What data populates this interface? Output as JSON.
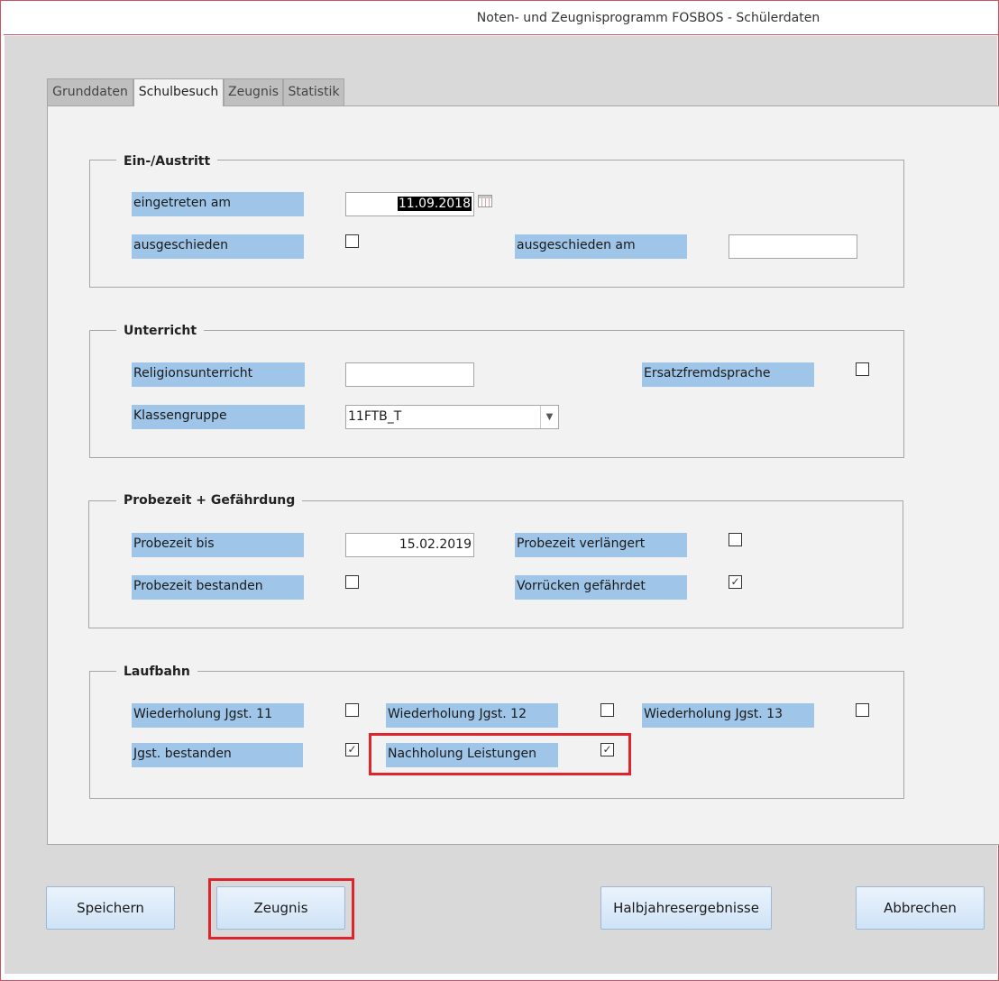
{
  "window": {
    "title": "Noten- und Zeugnisprogramm FOSBOS - Schülerdaten"
  },
  "tabs": [
    {
      "label": "Grunddaten",
      "active": false
    },
    {
      "label": "Schulbesuch",
      "active": true
    },
    {
      "label": "Zeugnis",
      "active": false
    },
    {
      "label": "Statistik",
      "active": false
    }
  ],
  "groups": {
    "eintritt": {
      "title": "Ein-/Austritt",
      "eingetreten_label": "eingetreten am",
      "eingetreten_value": "11.09.2018",
      "ausgeschieden_label": "ausgeschieden",
      "ausgeschieden_checked": "",
      "ausgeschieden_am_label": "ausgeschieden am",
      "ausgeschieden_am_value": ""
    },
    "unterricht": {
      "title": "Unterricht",
      "religion_label": "Religionsunterricht",
      "religion_value": "",
      "ersatz_label": "Ersatzfremdsprache",
      "ersatz_checked": "",
      "klassengruppe_label": "Klassengruppe",
      "klassengruppe_value": "11FTB_T"
    },
    "probezeit": {
      "title": "Probezeit + Gefährdung",
      "bis_label": "Probezeit bis",
      "bis_value": "15.02.2019",
      "verlaengert_label": "Probezeit verlängert",
      "verlaengert_checked": "",
      "bestanden_label": "Probezeit bestanden",
      "bestanden_checked": "",
      "gefaehrdet_label": "Vorrücken gefährdet",
      "gefaehrdet_checked": "✓"
    },
    "laufbahn": {
      "title": "Laufbahn",
      "wdh11_label": "Wiederholung Jgst. 11",
      "wdh11_checked": "",
      "wdh12_label": "Wiederholung Jgst. 12",
      "wdh12_checked": "",
      "wdh13_label": "Wiederholung Jgst. 13",
      "wdh13_checked": "",
      "jgst_bestanden_label": "Jgst. bestanden",
      "jgst_bestanden_checked": "✓",
      "nachholung_label": "Nachholung Leistungen",
      "nachholung_checked": "✓"
    }
  },
  "buttons": {
    "speichern": "Speichern",
    "zeugnis": "Zeugnis",
    "halbjahr": "Halbjahresergebnisse",
    "abbrechen": "Abbrechen"
  },
  "icons": {
    "calendar": "calendar-icon",
    "dropdown": "chevron-down-icon"
  },
  "colors": {
    "label_bg": "#9fc5e8",
    "highlight": "#e0242e",
    "button_bg": "#d6e8fa",
    "title_border": "#c8545e"
  }
}
